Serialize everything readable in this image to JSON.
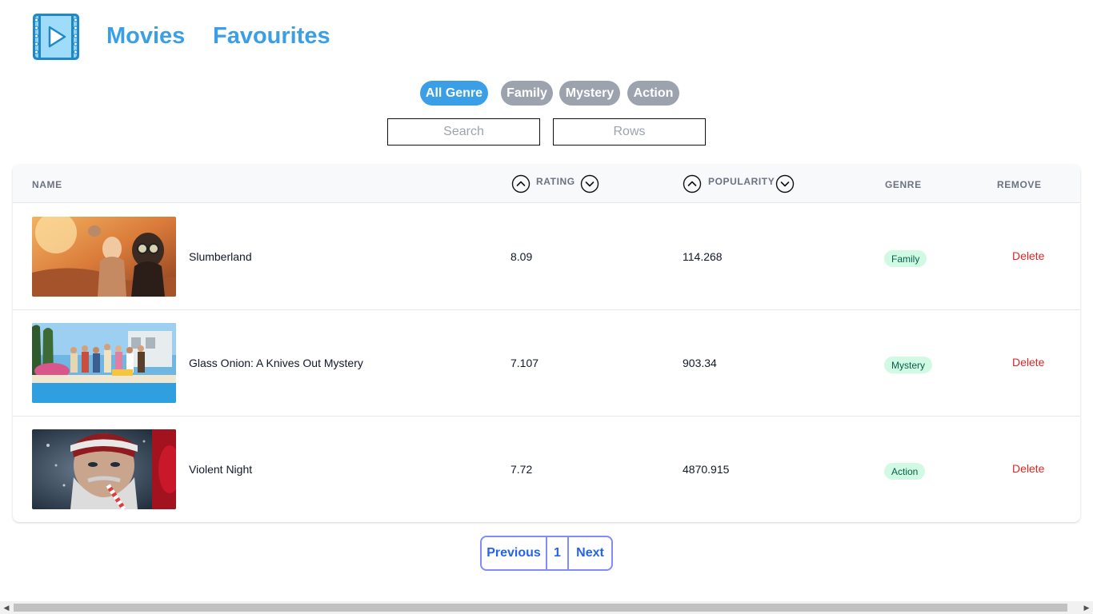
{
  "app": {
    "logo_icon": "film-play-icon",
    "nav": {
      "movies": "Movies",
      "favourites": "Favourites"
    },
    "accent_color": "#3b9fe8"
  },
  "filters": {
    "genres": [
      "All Genre",
      "Family",
      "Mystery",
      "Action"
    ],
    "selected_genre": "All Genre",
    "search_placeholder": "Search",
    "rows_placeholder": "Rows"
  },
  "table": {
    "headers": {
      "name": "NAME",
      "rating": "RATING",
      "popularity": "POPULARITY",
      "genre": "GENRE",
      "remove": "REMOVE"
    },
    "sort_icons": {
      "up": "chevron-up-circle-icon",
      "down": "chevron-down-circle-icon"
    },
    "rows": [
      {
        "name": "Slumberland",
        "rating": "8.09",
        "popularity": "114.268",
        "genre": "Family",
        "action": "Delete",
        "poster": "slumberland-poster"
      },
      {
        "name": "Glass Onion: A Knives Out Mystery",
        "rating": "7.107",
        "popularity": "903.34",
        "genre": "Mystery",
        "action": "Delete",
        "poster": "glass-onion-poster"
      },
      {
        "name": "Violent Night",
        "rating": "7.72",
        "popularity": "4870.915",
        "genre": "Action",
        "action": "Delete",
        "poster": "violent-night-poster"
      }
    ]
  },
  "pagination": {
    "previous": "Previous",
    "current_page": "1",
    "next": "Next"
  },
  "scrollbar": {
    "left_arrow": "◀",
    "right_arrow": "▶"
  }
}
